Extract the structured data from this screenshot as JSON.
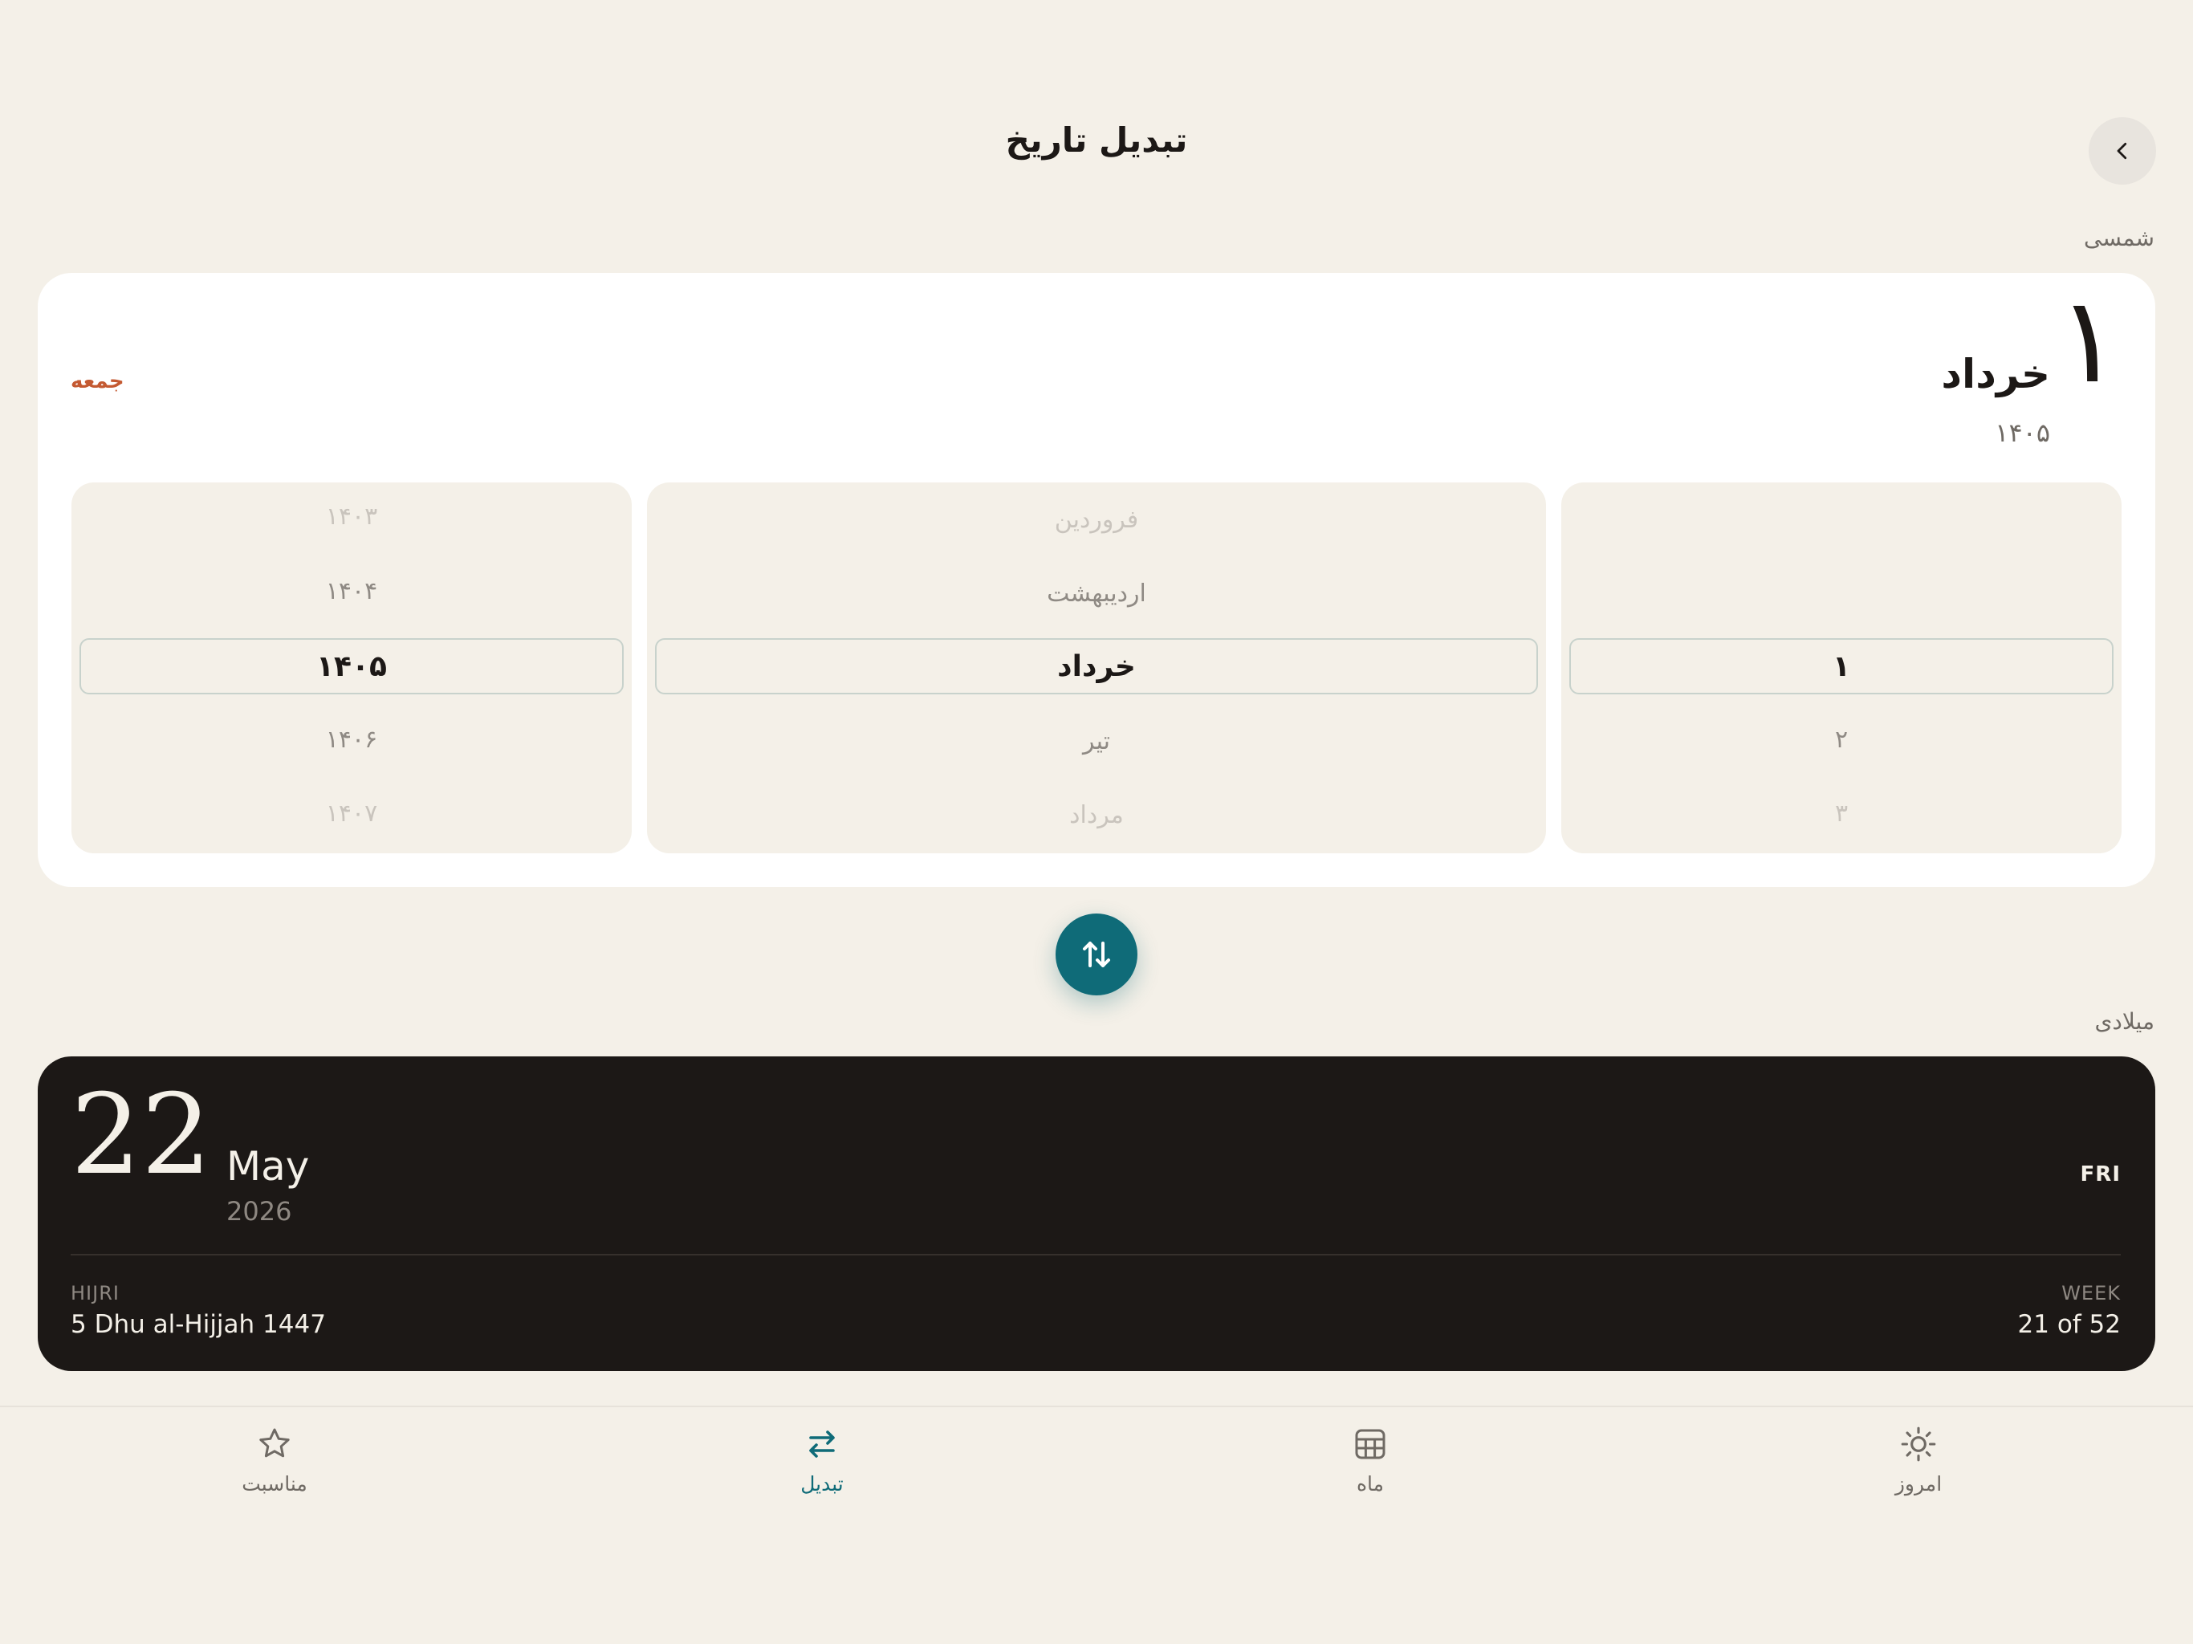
{
  "header": {
    "title": "تبدیل تاریخ",
    "back_icon": "chevron-left-icon"
  },
  "shamsi": {
    "section_label": "شمسی",
    "day": "۱",
    "month": "خرداد",
    "year": "۱۴۰۵",
    "weekday": "جمعه",
    "picker": {
      "years": [
        "۱۴۰۳",
        "۱۴۰۴",
        "۱۴۰۵",
        "۱۴۰۶",
        "۱۴۰۷"
      ],
      "months": [
        "فروردین",
        "اردیبهشت",
        "خرداد",
        "تیر",
        "مرداد"
      ],
      "days": [
        "",
        "",
        "۱",
        "۲",
        "۳"
      ]
    }
  },
  "swap": {
    "icon": "swap-vertical-icon"
  },
  "gregorian": {
    "section_label": "میلادی",
    "day": "22",
    "month": "May",
    "year": "2026",
    "weekday": "FRI",
    "hijri_label": "HIJRI",
    "hijri_value": "5 Dhu al-Hijjah 1447",
    "week_label": "WEEK",
    "week_value": "21 of 52"
  },
  "nav": {
    "items": [
      {
        "label": "مناسبت",
        "icon": "star-icon"
      },
      {
        "label": "تبدیل",
        "icon": "swap-horizontal-icon",
        "active": true
      },
      {
        "label": "ماه",
        "icon": "calendar-grid-icon"
      },
      {
        "label": "امروز",
        "icon": "sun-icon"
      }
    ]
  },
  "colors": {
    "background": "#f4f0e8",
    "accent": "#0f6b78",
    "weekday": "#c45a32",
    "dark_card": "#1c1816"
  }
}
